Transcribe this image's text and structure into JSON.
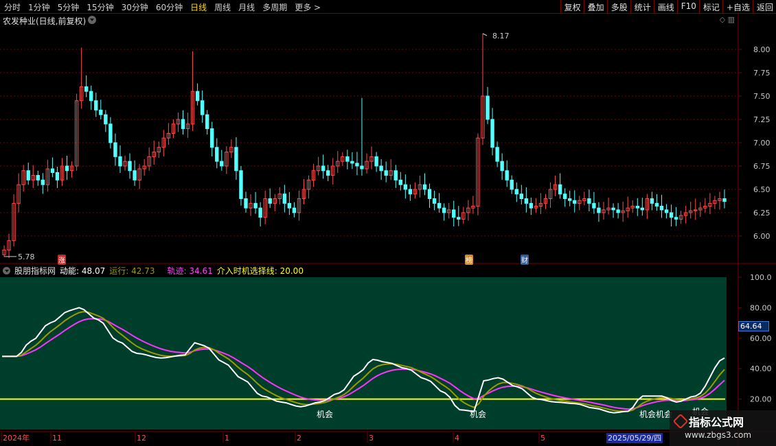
{
  "toolbar": {
    "periods": [
      "分时",
      "1分钟",
      "5分钟",
      "15分钟",
      "30分钟",
      "60分钟",
      "日线",
      "周线",
      "月线",
      "多周期",
      "更多 >"
    ],
    "active_index": 6,
    "right_buttons": [
      "复权",
      "叠加",
      "多股",
      "统计",
      "画线",
      "F10",
      "标记",
      "+自选",
      "返回"
    ]
  },
  "stock_title": "农发种业(日线,前复权)",
  "main_panel": {
    "price_labels": [
      "8.00",
      "7.75",
      "7.50",
      "7.25",
      "7.00",
      "6.75",
      "6.50",
      "6.25",
      "6.00"
    ],
    "high_label": "8.17",
    "low_label": "5.78",
    "marks": {
      "zhang": "涨",
      "bang": "榜",
      "cai": "财"
    }
  },
  "indicator": {
    "name": "股朋指标网",
    "dongneng_label": "动能:",
    "dongneng_value": "48.07",
    "yunxing_label": "运行:",
    "yunxing_value": "42.73",
    "guiji_label": "轨迹:",
    "guiji_value": "34.61",
    "jieru_label": "介入时机选择线:",
    "jieru_value": "20.00",
    "y_labels": [
      "100.0",
      "80.00",
      "60.00",
      "40.00",
      "20.00"
    ],
    "current_value": "64.64",
    "signal_text": "机会",
    "signal_text_double": "机会机会"
  },
  "time_axis": {
    "labels": [
      "2024年",
      "11",
      "12",
      "1",
      "2",
      "3",
      "4",
      "5"
    ],
    "cursor_date": "2025/05/29/四"
  },
  "watermark": {
    "title": "指标公式网",
    "url": "www.zbgs3.com"
  },
  "colors": {
    "bg": "#000000",
    "grid": "#7a0000",
    "up": "#ff4d4d",
    "down": "#54ffff",
    "panel": "#003e2c",
    "white_line": "#ffffff",
    "olive_line": "#9a9a00",
    "magenta_line": "#ff33ff",
    "yellow_line": "#ffff00"
  }
}
